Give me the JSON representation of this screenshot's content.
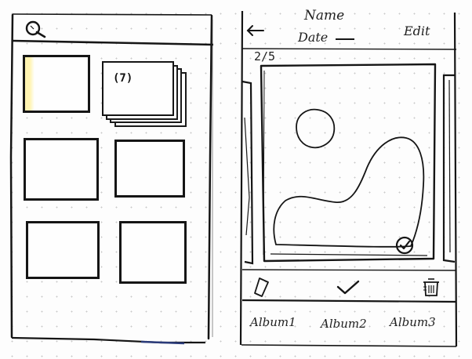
{
  "gallery_screen": {
    "search_icon": "search-icon",
    "stack_count": "(7)",
    "thumbnails": [
      "photo-1",
      "album-stack",
      "photo-3",
      "photo-4",
      "photo-5",
      "photo-6"
    ]
  },
  "photo_screen": {
    "header": {
      "back_icon": "arrow-left-icon",
      "name": "Name",
      "date": "Date",
      "edit": "Edit"
    },
    "counter": "2/5",
    "selected_icon": "check-circle-icon",
    "actions": {
      "edit_icon": "pencil-icon",
      "confirm_icon": "checkmark-icon",
      "delete_icon": "trash-icon"
    },
    "albums": [
      "Album1",
      "Album2",
      "Album3"
    ]
  },
  "colors": {
    "ink": "#151515",
    "highlight": "#fff3b0",
    "dot_grid": "#c9c9c9"
  }
}
